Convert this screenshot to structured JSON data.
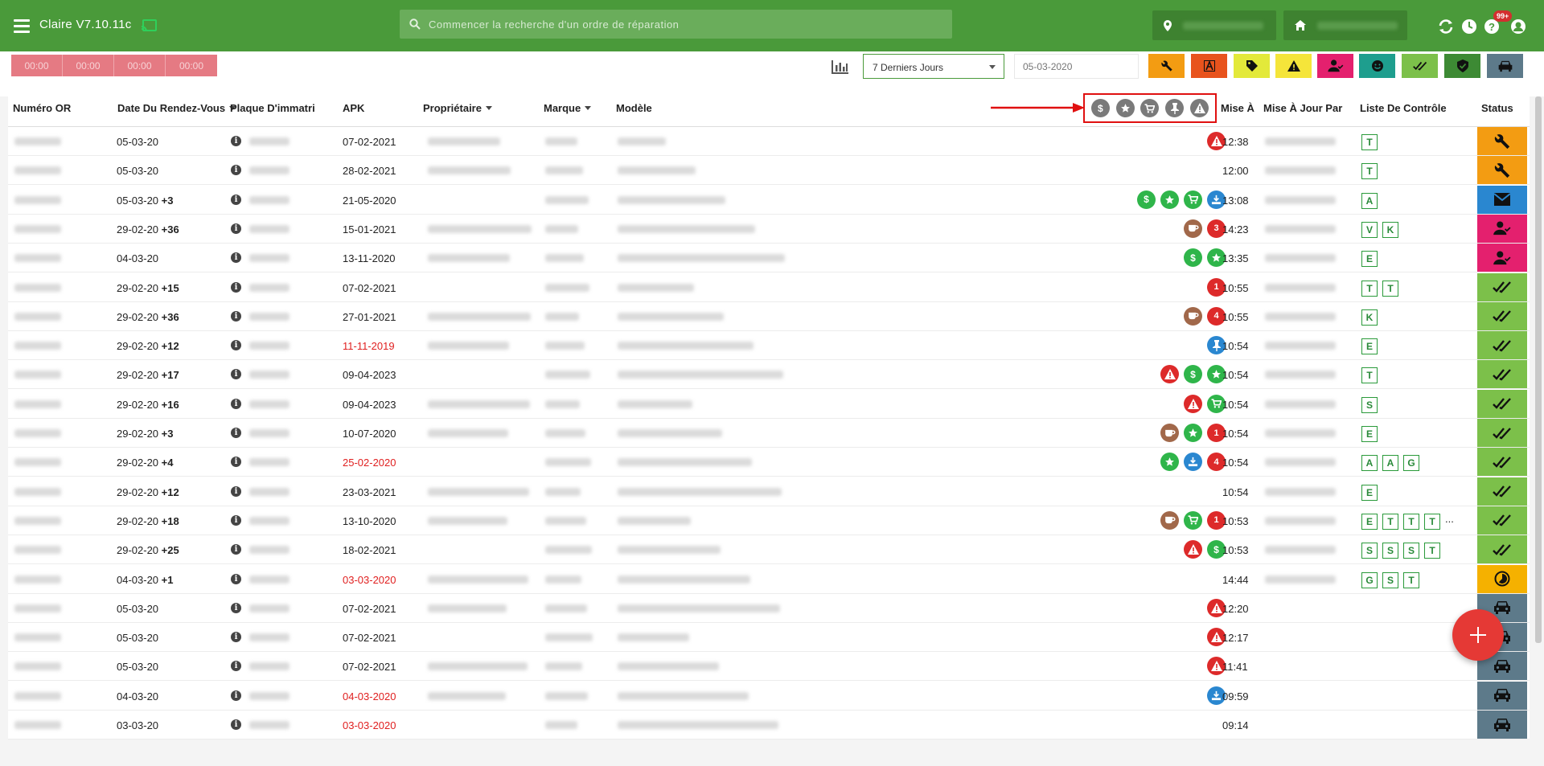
{
  "app": {
    "title": "Claire V7.10.11c"
  },
  "search": {
    "placeholder": "Commencer la recherche d'un ordre de réparation"
  },
  "topbar": {
    "badge": "99+"
  },
  "timers": [
    "00:00",
    "00:00",
    "00:00",
    "00:00"
  ],
  "filter": {
    "period": "7 Derniers Jours",
    "date_placeholder": "05-03-2020"
  },
  "filter_buttons": [
    {
      "icon": "wrench-icon",
      "color": "#f39c12"
    },
    {
      "icon": "a-box-icon",
      "color": "#e8531d"
    },
    {
      "icon": "tag-icon",
      "color": "#e3e93a"
    },
    {
      "icon": "warning-icon",
      "color": "#f5e53a"
    },
    {
      "icon": "user-check-icon",
      "color": "#e4206e"
    },
    {
      "icon": "smile-icon",
      "color": "#1e9e8e"
    },
    {
      "icon": "double-check-icon",
      "color": "#7cc04a"
    },
    {
      "icon": "shield-check-icon",
      "color": "#3d8a34"
    },
    {
      "icon": "car-icon",
      "color": "#5d7a8a"
    }
  ],
  "columns": {
    "numero": "Numéro OR",
    "date": "Date Du Rendez-Vous",
    "plaque": "Plaque D'immatriculati",
    "apk": "APK",
    "proprietaire": "Propriétaire",
    "marque": "Marque",
    "modele": "Modèle",
    "mise": "Mise À",
    "mise_par": "Mise À Jour Par",
    "liste": "Liste De Contrôle",
    "status": "Status"
  },
  "header_icons": [
    "dollar-icon",
    "star-icon",
    "cart-icon",
    "pin-icon",
    "warning-icon"
  ],
  "rows": [
    {
      "date": "05-03-20",
      "plus": "",
      "apk": "07-02-2021",
      "apk_red": false,
      "icons": [
        [
          "red",
          "warning"
        ]
      ],
      "time": "12:38",
      "checks": [
        "T"
      ],
      "status": "wrench"
    },
    {
      "date": "05-03-20",
      "plus": "",
      "apk": "28-02-2021",
      "apk_red": false,
      "icons": [],
      "time": "12:00",
      "checks": [
        "T"
      ],
      "status": "wrench"
    },
    {
      "date": "05-03-20",
      "plus": "+3",
      "apk": "21-05-2020",
      "apk_red": false,
      "icons": [
        [
          "green",
          "$"
        ],
        [
          "green",
          "star"
        ],
        [
          "green",
          "cart"
        ],
        [
          "blue",
          "tray"
        ]
      ],
      "time": "13:08",
      "checks": [
        "A"
      ],
      "status": "mail"
    },
    {
      "date": "29-02-20",
      "plus": "+36",
      "apk": "15-01-2021",
      "apk_red": false,
      "icons": [
        [
          "brown",
          "cup"
        ],
        [
          "red",
          "3"
        ]
      ],
      "time": "14:23",
      "checks": [
        "V",
        "K"
      ],
      "status": "user"
    },
    {
      "date": "04-03-20",
      "plus": "",
      "apk": "13-11-2020",
      "apk_red": false,
      "icons": [
        [
          "green",
          "$"
        ],
        [
          "green",
          "star"
        ]
      ],
      "time": "13:35",
      "checks": [
        "E"
      ],
      "status": "user"
    },
    {
      "date": "29-02-20",
      "plus": "+15",
      "apk": "07-02-2021",
      "apk_red": false,
      "icons": [
        [
          "red",
          "1"
        ]
      ],
      "time": "10:55",
      "checks": [
        "T",
        "T"
      ],
      "status": "check"
    },
    {
      "date": "29-02-20",
      "plus": "+36",
      "apk": "27-01-2021",
      "apk_red": false,
      "icons": [
        [
          "brown",
          "cup"
        ],
        [
          "red",
          "4"
        ]
      ],
      "time": "10:55",
      "checks": [
        "K"
      ],
      "status": "check"
    },
    {
      "date": "29-02-20",
      "plus": "+12",
      "apk": "11-11-2019",
      "apk_red": true,
      "icons": [
        [
          "blue",
          "pin"
        ]
      ],
      "time": "10:54",
      "checks": [
        "E"
      ],
      "status": "check"
    },
    {
      "date": "29-02-20",
      "plus": "+17",
      "apk": "09-04-2023",
      "apk_red": false,
      "icons": [
        [
          "red",
          "warning"
        ],
        [
          "green",
          "$"
        ],
        [
          "green",
          "star"
        ]
      ],
      "time": "10:54",
      "checks": [
        "T"
      ],
      "status": "check"
    },
    {
      "date": "29-02-20",
      "plus": "+16",
      "apk": "09-04-2023",
      "apk_red": false,
      "icons": [
        [
          "red",
          "warning"
        ],
        [
          "green",
          "cart"
        ]
      ],
      "time": "10:54",
      "checks": [
        "S"
      ],
      "status": "check"
    },
    {
      "date": "29-02-20",
      "plus": "+3",
      "apk": "10-07-2020",
      "apk_red": false,
      "icons": [
        [
          "brown",
          "cup"
        ],
        [
          "green",
          "star"
        ],
        [
          "red",
          "1"
        ]
      ],
      "time": "10:54",
      "checks": [
        "E"
      ],
      "status": "check"
    },
    {
      "date": "29-02-20",
      "plus": "+4",
      "apk": "25-02-2020",
      "apk_red": true,
      "icons": [
        [
          "green",
          "star"
        ],
        [
          "blue",
          "tray"
        ],
        [
          "red",
          "4"
        ]
      ],
      "time": "10:54",
      "checks": [
        "A",
        "A",
        "G"
      ],
      "status": "check"
    },
    {
      "date": "29-02-20",
      "plus": "+12",
      "apk": "23-03-2021",
      "apk_red": false,
      "icons": [],
      "time": "10:54",
      "checks": [
        "E"
      ],
      "status": "check"
    },
    {
      "date": "29-02-20",
      "plus": "+18",
      "apk": "13-10-2020",
      "apk_red": false,
      "icons": [
        [
          "brown",
          "cup"
        ],
        [
          "green",
          "cart"
        ],
        [
          "red",
          "1"
        ]
      ],
      "time": "10:53",
      "checks": [
        "E",
        "T",
        "T",
        "T"
      ],
      "more": "...",
      "status": "check"
    },
    {
      "date": "29-02-20",
      "plus": "+25",
      "apk": "18-02-2021",
      "apk_red": false,
      "icons": [
        [
          "red",
          "warning"
        ],
        [
          "green",
          "$"
        ]
      ],
      "time": "10:53",
      "checks": [
        "S",
        "S",
        "S",
        "T"
      ],
      "status": "check"
    },
    {
      "date": "04-03-20",
      "plus": "+1",
      "apk": "03-03-2020",
      "apk_red": true,
      "icons": [],
      "time": "14:44",
      "checks": [
        "G",
        "S",
        "T"
      ],
      "status": "clock"
    },
    {
      "date": "05-03-20",
      "plus": "",
      "apk": "07-02-2021",
      "apk_red": false,
      "icons": [
        [
          "red",
          "warning"
        ]
      ],
      "time": "12:20",
      "checks": [],
      "status": "car"
    },
    {
      "date": "05-03-20",
      "plus": "",
      "apk": "07-02-2021",
      "apk_red": false,
      "icons": [
        [
          "red",
          "warning"
        ]
      ],
      "time": "12:17",
      "checks": [],
      "status": "car"
    },
    {
      "date": "05-03-20",
      "plus": "",
      "apk": "07-02-2021",
      "apk_red": false,
      "icons": [
        [
          "red",
          "warning"
        ]
      ],
      "time": "11:41",
      "checks": [],
      "status": "car"
    },
    {
      "date": "04-03-20",
      "plus": "",
      "apk": "04-03-2020",
      "apk_red": true,
      "icons": [
        [
          "blue",
          "tray"
        ]
      ],
      "time": "09:59",
      "checks": [],
      "status": "car"
    },
    {
      "date": "03-03-20",
      "plus": "",
      "apk": "03-03-2020",
      "apk_red": true,
      "icons": [],
      "time": "09:14",
      "checks": [],
      "status": "car"
    }
  ],
  "status_colors": {
    "wrench": "#f39c12",
    "mail": "#2a87d0",
    "user": "#e4206e",
    "check": "#7cc04a",
    "clock": "#f5b100",
    "car": "#5d7a8a"
  }
}
